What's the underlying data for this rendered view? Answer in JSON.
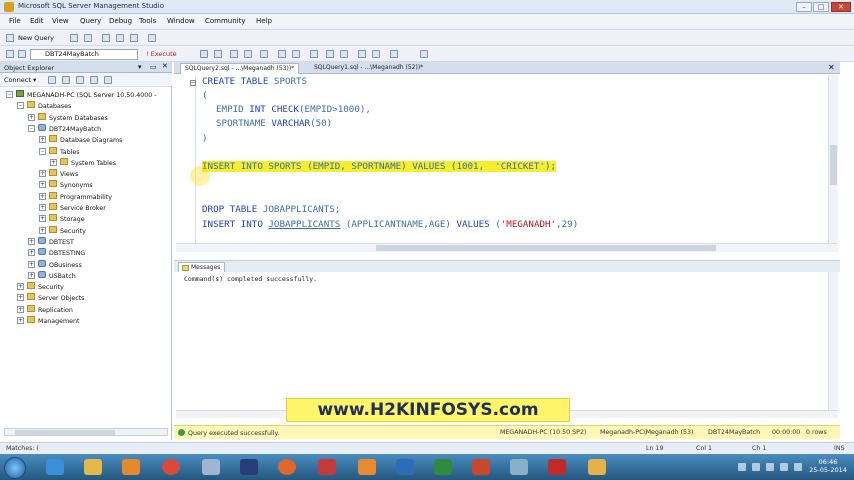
{
  "window": {
    "title": "Microsoft SQL Server Management Studio",
    "minimize": "–",
    "maximize": "□",
    "close": "✕"
  },
  "menu": [
    "File",
    "Edit",
    "View",
    "Query",
    "Debug",
    "Tools",
    "Window",
    "Community",
    "Help"
  ],
  "toolbar1": {
    "new_query": "New Query"
  },
  "toolbar2": {
    "database": "DBT24MayBatch",
    "execute": "! Execute"
  },
  "object_explorer": {
    "title": "Object Explorer",
    "connect": "Connect ▾",
    "tree": [
      {
        "label": "MEGANADH-PC (SQL Server 10.50.4000 -",
        "level": 0,
        "toggle": "–",
        "kind": "srv"
      },
      {
        "label": "Databases",
        "level": 1,
        "toggle": "–",
        "kind": "folder"
      },
      {
        "label": "System Databases",
        "level": 2,
        "toggle": "+",
        "kind": "folder"
      },
      {
        "label": "DBT24MayBatch",
        "level": 2,
        "toggle": "–",
        "kind": "db"
      },
      {
        "label": "Database Diagrams",
        "level": 3,
        "toggle": "+",
        "kind": "folder"
      },
      {
        "label": "Tables",
        "level": 3,
        "toggle": "–",
        "kind": "folder"
      },
      {
        "label": "System Tables",
        "level": 4,
        "toggle": "+",
        "kind": "folder"
      },
      {
        "label": "Views",
        "level": 3,
        "toggle": "+",
        "kind": "folder"
      },
      {
        "label": "Synonyms",
        "level": 3,
        "toggle": "+",
        "kind": "folder"
      },
      {
        "label": "Programmability",
        "level": 3,
        "toggle": "+",
        "kind": "folder"
      },
      {
        "label": "Service Broker",
        "level": 3,
        "toggle": "+",
        "kind": "folder"
      },
      {
        "label": "Storage",
        "level": 3,
        "toggle": "+",
        "kind": "folder"
      },
      {
        "label": "Security",
        "level": 3,
        "toggle": "+",
        "kind": "folder"
      },
      {
        "label": "DBTEST",
        "level": 2,
        "toggle": "+",
        "kind": "db"
      },
      {
        "label": "DBTESTING",
        "level": 2,
        "toggle": "+",
        "kind": "db"
      },
      {
        "label": "OBusiness",
        "level": 2,
        "toggle": "+",
        "kind": "db"
      },
      {
        "label": "USBatch",
        "level": 2,
        "toggle": "+",
        "kind": "db"
      },
      {
        "label": "Security",
        "level": 1,
        "toggle": "+",
        "kind": "folder"
      },
      {
        "label": "Server Objects",
        "level": 1,
        "toggle": "+",
        "kind": "folder"
      },
      {
        "label": "Replication",
        "level": 1,
        "toggle": "+",
        "kind": "folder"
      },
      {
        "label": "Management",
        "level": 1,
        "toggle": "+",
        "kind": "folder"
      }
    ]
  },
  "tabs": [
    {
      "label": "SQLQuery2.sql - ...\\Meganadh (53))*",
      "active": true
    },
    {
      "label": "SQLQuery1.sql - ...\\Meganadh (52))*",
      "active": false
    }
  ],
  "editor": {
    "l1": {
      "a": "CREATE TABLE ",
      "b": "SPORTS"
    },
    "l2": "(",
    "l3": {
      "a": "EMPID ",
      "b": "INT CHECK",
      "c": "(EMPID>1000),"
    },
    "l4": {
      "a": "SPORTNAME ",
      "b": "VARCHAR",
      "c": "(50)"
    },
    "l5": ")",
    "l6": "INSERT INTO SPORTS (EMPID, SPORTNAME) VALUES (1001,  'CRICKET');",
    "l7": {
      "a": "DROP TABLE ",
      "b": "JOBAPPLICANTS;"
    },
    "l8": {
      "a": "INSERT INTO ",
      "b": "JOBAPPLICANTS",
      "c": " (APPLICANTNAME,AGE) ",
      "d": "VALUES",
      "e": " (",
      "f": "'MEGANADH'",
      "g": ",29)"
    }
  },
  "messages": {
    "tab": "Messages",
    "text": "Command(s) completed successfully."
  },
  "watermark": "www.H2KINFOSYS.com",
  "query_status": {
    "message": "Query executed successfully.",
    "server": "MEGANADH-PC (10.50 SP2)",
    "user": "Meganadh-PC\\Meganadh (53)",
    "database": "DBT24MayBatch",
    "time": "00:00:00",
    "rows": "0 rows"
  },
  "app_status": {
    "left": "Matches: (",
    "ln": "Ln 19",
    "col": "Col 1",
    "ch": "Ch 1",
    "ins": "INS"
  },
  "clock": {
    "time": "06:46",
    "date": "25-05-2014"
  }
}
